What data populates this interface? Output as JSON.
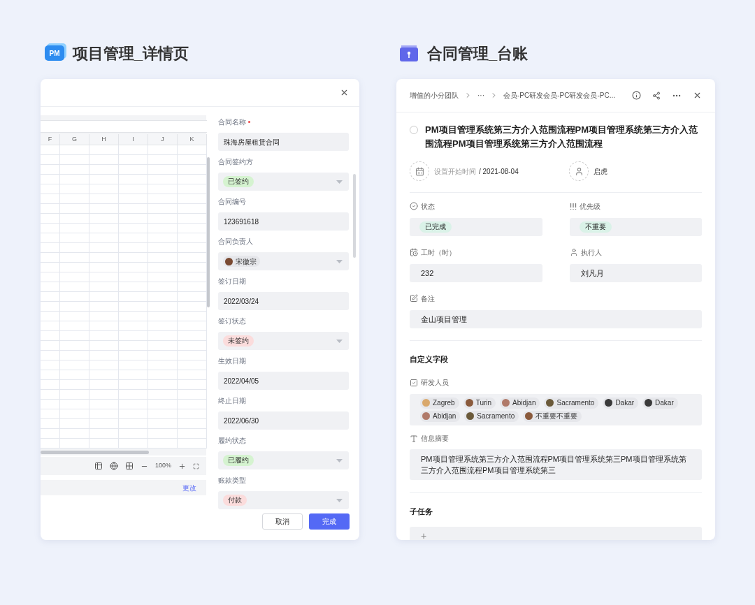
{
  "left_section": {
    "logo_text": "PM",
    "title": "项目管理_详情页"
  },
  "right_section": {
    "title": "合同管理_台账"
  },
  "left_panel": {
    "spreadsheet": {
      "columns": [
        "F",
        "G",
        "H",
        "I",
        "J",
        "K"
      ],
      "zoom": "100%",
      "change_link": "更改"
    },
    "form": [
      {
        "label": "合同名称",
        "required": true,
        "kind": "text",
        "value": "珠海房屋租赁合同"
      },
      {
        "label": "合同签约方",
        "required": false,
        "kind": "tag",
        "value": "已签约",
        "color": "#d5f3d0"
      },
      {
        "label": "合同编号",
        "required": false,
        "kind": "text",
        "value": "123691618"
      },
      {
        "label": "合同负责人",
        "required": false,
        "kind": "person",
        "value": "宋徽宗"
      },
      {
        "label": "签订日期",
        "required": false,
        "kind": "text",
        "value": "2022/03/24"
      },
      {
        "label": "签订状态",
        "required": false,
        "kind": "tag",
        "value": "未签约",
        "color": "#fbdcdc"
      },
      {
        "label": "生效日期",
        "required": false,
        "kind": "text",
        "value": "2022/04/05"
      },
      {
        "label": "终止日期",
        "required": false,
        "kind": "text",
        "value": "2022/06/30"
      },
      {
        "label": "履约状态",
        "required": false,
        "kind": "tag",
        "value": "已履约",
        "color": "#d5f3d0"
      },
      {
        "label": "账款类型",
        "required": false,
        "kind": "tag",
        "value": "付款",
        "color": "#fbdcdc"
      }
    ],
    "buttons": {
      "cancel": "取消",
      "confirm": "完成"
    }
  },
  "right_panel": {
    "breadcrumb": [
      "增值的小分团队",
      "···",
      "会员-PC研发会员-PC研发会员-PC..."
    ],
    "task": {
      "completed": false,
      "title": "PM项目管理系统第三方介入范围流程PM项目管理系统第三方介入范围流程PM项目管理系统第三方介入范围流程"
    },
    "start": {
      "label": "设置开始时间",
      "value": "/ 2021-08-04"
    },
    "owner": "启虎",
    "fields": [
      {
        "label": "状态",
        "kind": "tag",
        "value": "已完成",
        "color": "#daf2e8"
      },
      {
        "label": "优先级",
        "kind": "tag",
        "value": "不重要",
        "color": "#daf2e8"
      },
      {
        "label": "工时（时）",
        "kind": "text",
        "value": "232"
      },
      {
        "label": "执行人",
        "kind": "text",
        "value": "刘凡月"
      }
    ],
    "remark": {
      "label": "备注",
      "value": "金山项目管理"
    },
    "custom_title": "自定义字段",
    "developers": {
      "label": "研发人员",
      "people": [
        "Zagreb",
        "Turin",
        "Abidjan",
        "Sacramento",
        "Dakar",
        "Dakar",
        "Abidjan",
        "Sacramento",
        "不重要不重要"
      ]
    },
    "summary": {
      "label": "信息摘要",
      "value": "PM项目管理系统第三方介入范围流程PM项目管理系统第三PM项目管理系统第三方介入范围流程PM项目管理系统第三"
    },
    "subtasks": {
      "title": "子任务",
      "add": "+"
    }
  }
}
